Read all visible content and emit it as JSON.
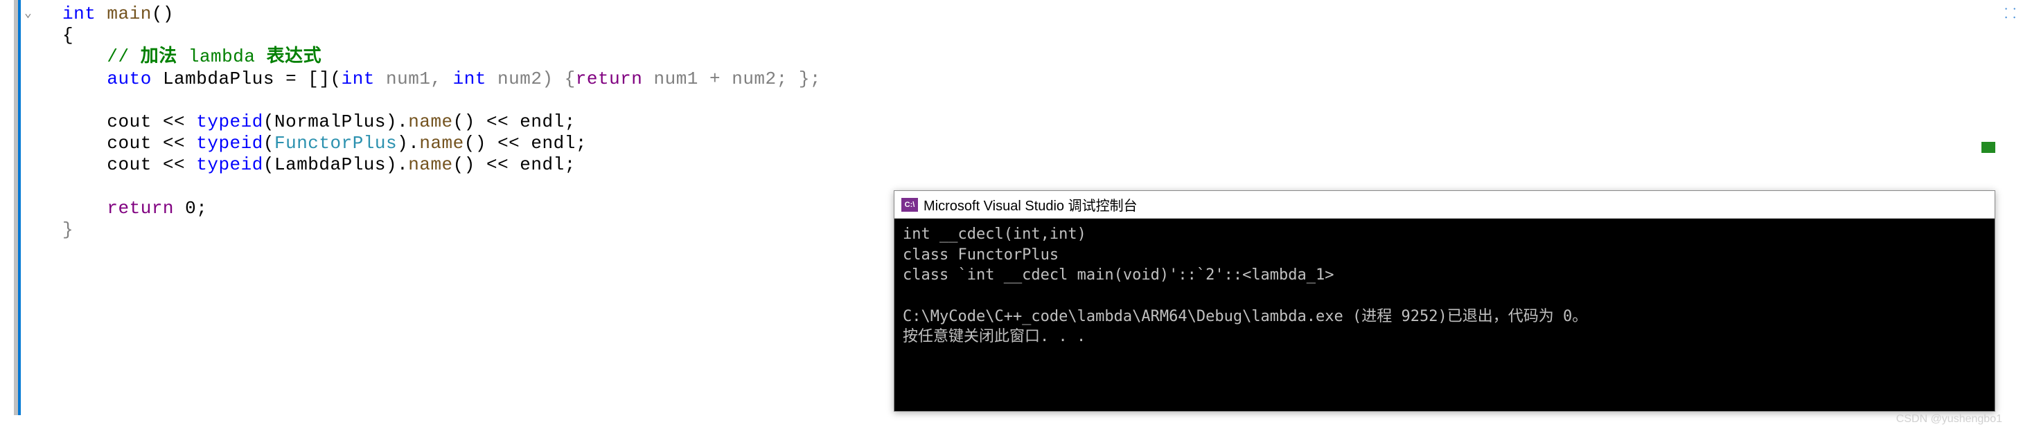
{
  "code": {
    "l1_int": "int",
    "l1_main": " main",
    "l1_paren": "()",
    "l2": "{",
    "l3_comment_prefix": "// ",
    "l3_comment_cn1": "加法",
    "l3_comment_en": " lambda ",
    "l3_comment_cn2": "表达式",
    "l4_auto": "auto",
    "l4_name": " LambdaPlus ",
    "l4_eq": "= [](",
    "l4_int1": "int",
    "l4_p1": " num1, ",
    "l4_int2": "int",
    "l4_p2": " num2) {",
    "l4_return": "return",
    "l4_expr": " num1 + num2; };",
    "l6_cout": "cout ",
    "l6_op": "<< ",
    "l6_typeid": "typeid",
    "l6_open": "(",
    "l6_arg": "NormalPlus",
    "l6_close": ").",
    "l6_name": "name",
    "l6_call": "() ",
    "l6_op2": "<< ",
    "l6_endl": "endl",
    "l6_semi": ";",
    "l7_arg": "FunctorPlus",
    "l8_arg": "LambdaPlus",
    "l10_return": "return",
    "l10_val": " 0;",
    "l11": "}"
  },
  "console": {
    "icon_text": "C:\\",
    "title": "Microsoft Visual Studio 调试控制台",
    "line1": "int __cdecl(int,int)",
    "line2": "class FunctorPlus",
    "line3": "class `int __cdecl main(void)'::`2'::<lambda_1>",
    "line4": "",
    "line5": "C:\\MyCode\\C++_code\\lambda\\ARM64\\Debug\\lambda.exe (进程 9252)已退出，代码为 0。",
    "line6": "按任意键关闭此窗口. . ."
  },
  "watermark": "CSDN @yushengbo1"
}
